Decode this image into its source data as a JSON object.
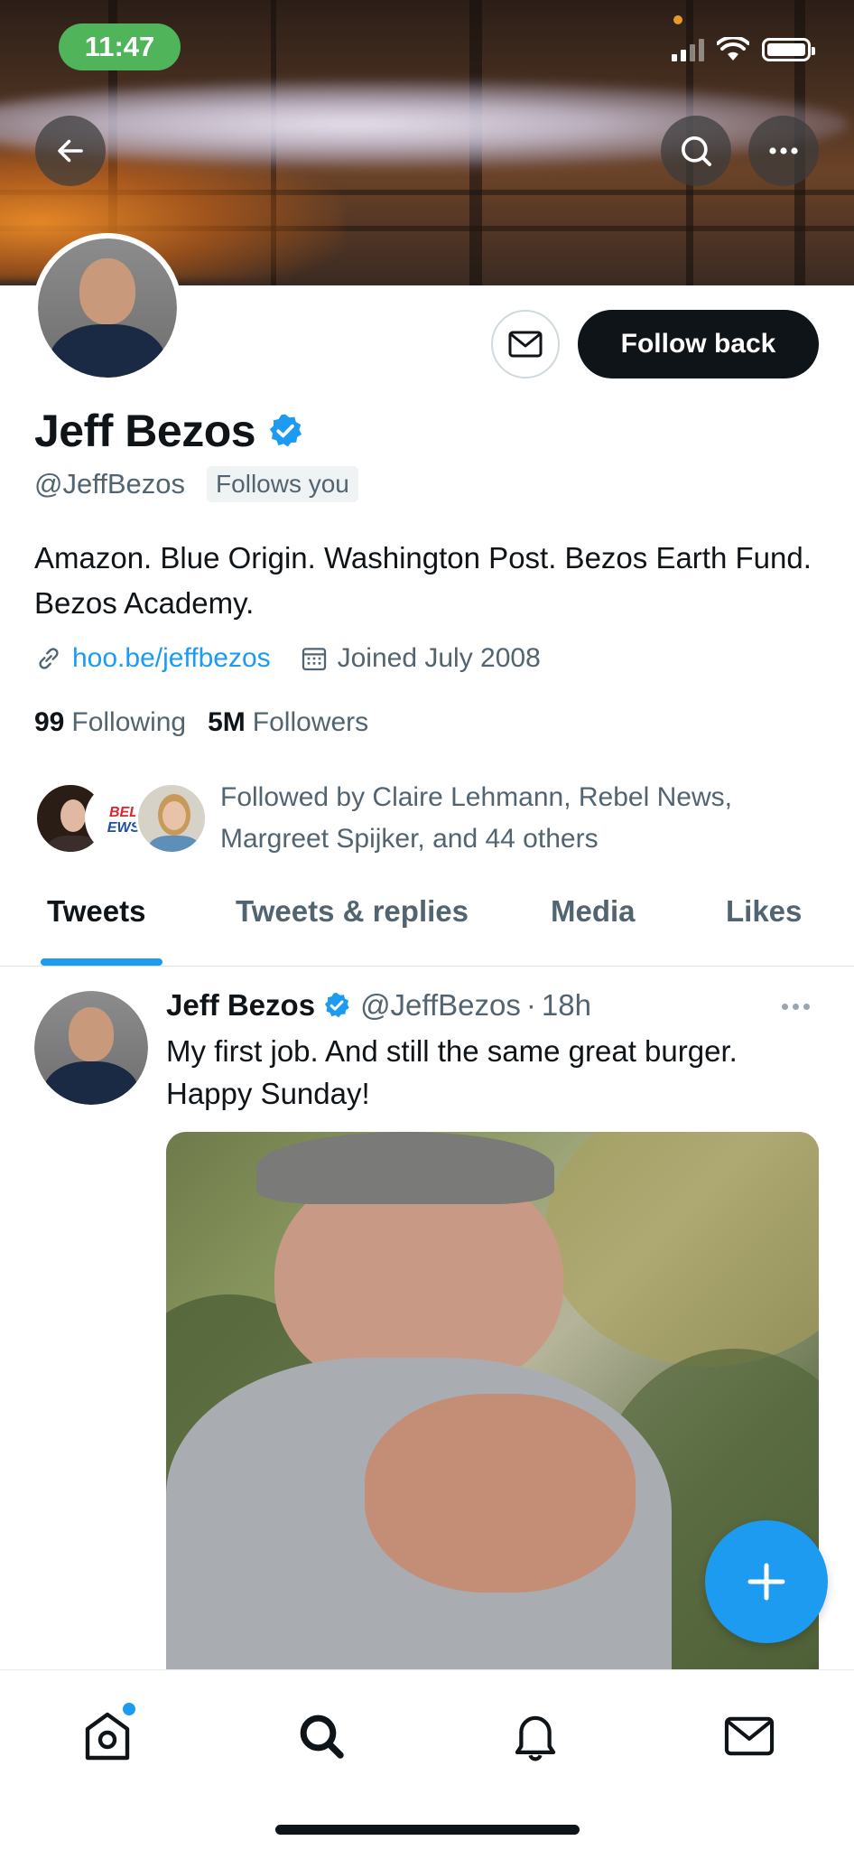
{
  "status_bar": {
    "time": "11:47"
  },
  "profile": {
    "name": "Jeff Bezos",
    "handle": "@JeffBezos",
    "follows_you": "Follows you",
    "bio": "Amazon. Blue Origin. Washington Post. Bezos Earth Fund. Bezos Academy.",
    "website": "hoo.be/jeffbezos",
    "joined": "Joined July 2008",
    "following_count": "99",
    "following_label": "Following",
    "followers_count": "5M",
    "followers_label": "Followers",
    "followed_by": "Followed by Claire Lehmann, Rebel News, Margreet Spijker, and 44 others",
    "follow_button": "Follow back",
    "rebel_news_logo": [
      "BEL",
      "EWS"
    ]
  },
  "tabs": [
    {
      "label": "Tweets",
      "active": true
    },
    {
      "label": "Tweets & replies",
      "active": false
    },
    {
      "label": "Media",
      "active": false
    },
    {
      "label": "Likes",
      "active": false
    }
  ],
  "tweet": {
    "author_name": "Jeff Bezos",
    "author_handle": "@JeffBezos",
    "separator": "·",
    "time": "18h",
    "text": "My first job. And still the same great burger. Happy Sunday!"
  },
  "icons": {
    "back": "back-arrow-icon",
    "search": "search-icon",
    "more": "more-horizontal-icon",
    "message": "mail-icon",
    "verified": "verified-badge-icon",
    "link": "link-icon",
    "calendar": "calendar-icon",
    "compose": "plus-icon",
    "nav": [
      "home-icon",
      "search-icon",
      "bell-icon",
      "mail-icon"
    ]
  },
  "colors": {
    "accent": "#1d9bf0",
    "text_primary": "#0f1419",
    "text_secondary": "#536471",
    "status_pill": "#4fb45a"
  }
}
